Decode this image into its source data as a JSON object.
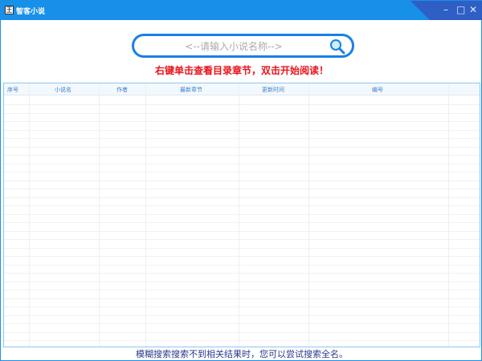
{
  "window": {
    "title": "智客小说",
    "icon_text": "王",
    "minimize": "–",
    "maximize": "□",
    "close": "✕"
  },
  "search": {
    "placeholder": "<--请输入小说名称-->",
    "value": ""
  },
  "hint": "右键单击查看目录章节，双击开始阅读！",
  "table": {
    "columns": [
      "序号",
      "小说名",
      "作者",
      "最新章节",
      "更新时间",
      "编号"
    ],
    "rows": []
  },
  "footer": "模糊搜索搜索不到相关结果时，您可以尝试搜索全名。"
}
